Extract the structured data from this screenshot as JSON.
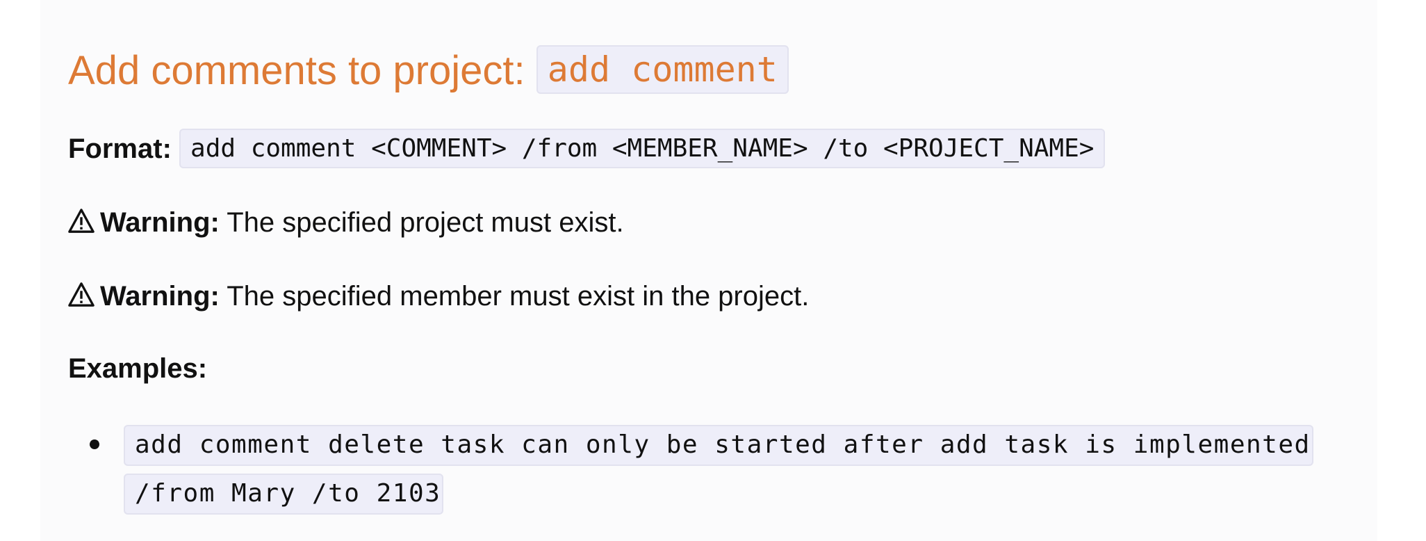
{
  "section": {
    "title_text": "Add comments to project: ",
    "title_command": "add comment"
  },
  "format": {
    "label": "Format:",
    "code": "add comment <COMMENT> /from <MEMBER_NAME> /to <PROJECT_NAME>"
  },
  "warnings": [
    {
      "icon": "warning-icon",
      "label": "Warning:",
      "text": " The specified project must exist."
    },
    {
      "icon": "warning-icon",
      "label": "Warning:",
      "text": " The specified member must exist in the project."
    }
  ],
  "examples": {
    "label": "Examples:",
    "items": [
      "add comment delete task can only be started after add task is implemented /from Mary /to 2103"
    ]
  },
  "colors": {
    "heading": "#dd7a35",
    "code_background": "#eeeef9",
    "page_background": "#fbfbfc"
  }
}
